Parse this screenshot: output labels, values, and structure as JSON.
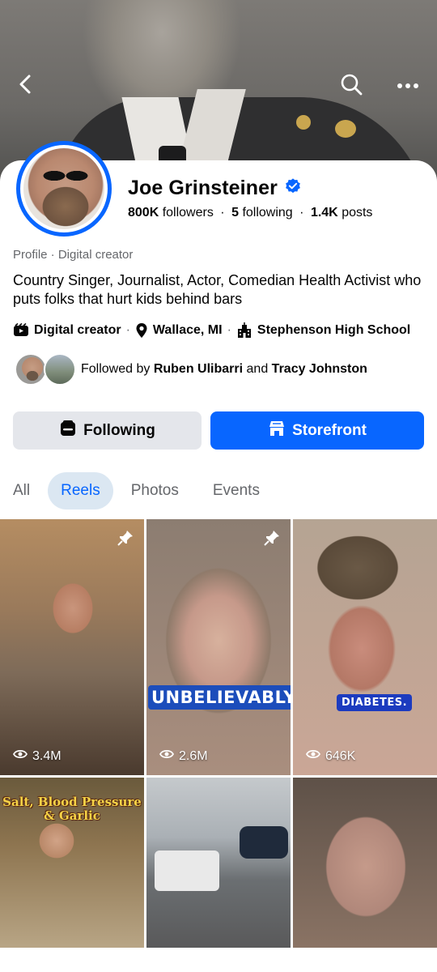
{
  "header": {
    "back_label": "Back",
    "search_label": "Search",
    "more_label": "More"
  },
  "profile": {
    "name": "Joe Grinsteiner",
    "verified": true,
    "followers_count": "800K",
    "followers_label": "followers",
    "following_count": "5",
    "following_label": "following",
    "posts_count": "1.4K",
    "posts_label": "posts",
    "meta": "Profile · Digital creator",
    "bio": "Country Singer, Journalist, Actor, Comedian Health Activist who puts folks that hurt kids behind bars",
    "details": [
      {
        "icon": "video-icon",
        "text": "Digital creator"
      },
      {
        "icon": "location-pin-icon",
        "text": "Wallace, MI"
      },
      {
        "icon": "school-building-icon",
        "text": "Stephenson High School"
      }
    ],
    "followed_by_prefix": "Followed by",
    "followed_by_1": "Ruben Ulibarri",
    "followed_by_and": "and",
    "followed_by_2": "Tracy Johnston"
  },
  "actions": {
    "following_label": "Following",
    "storefront_label": "Storefront"
  },
  "tabs": [
    {
      "label": "All",
      "active": false
    },
    {
      "label": "Reels",
      "active": true
    },
    {
      "label": "Photos",
      "active": false
    },
    {
      "label": "Events",
      "active": false
    }
  ],
  "reels": [
    {
      "views": "3.4M",
      "pinned": true,
      "caption": ""
    },
    {
      "views": "2.6M",
      "pinned": true,
      "caption": "UNBELIEVABLY"
    },
    {
      "views": "646K",
      "pinned": false,
      "caption": "DIABETES."
    },
    {
      "views": "",
      "pinned": false,
      "caption": "Salt, Blood Pressure & Garlic"
    },
    {
      "views": "",
      "pinned": false,
      "caption": ""
    },
    {
      "views": "",
      "pinned": false,
      "caption": ""
    }
  ],
  "colors": {
    "accent": "#0866ff",
    "secondary_button": "#e4e6eb",
    "active_tab_bg": "#dbe7f2",
    "muted_text": "#65676b"
  }
}
